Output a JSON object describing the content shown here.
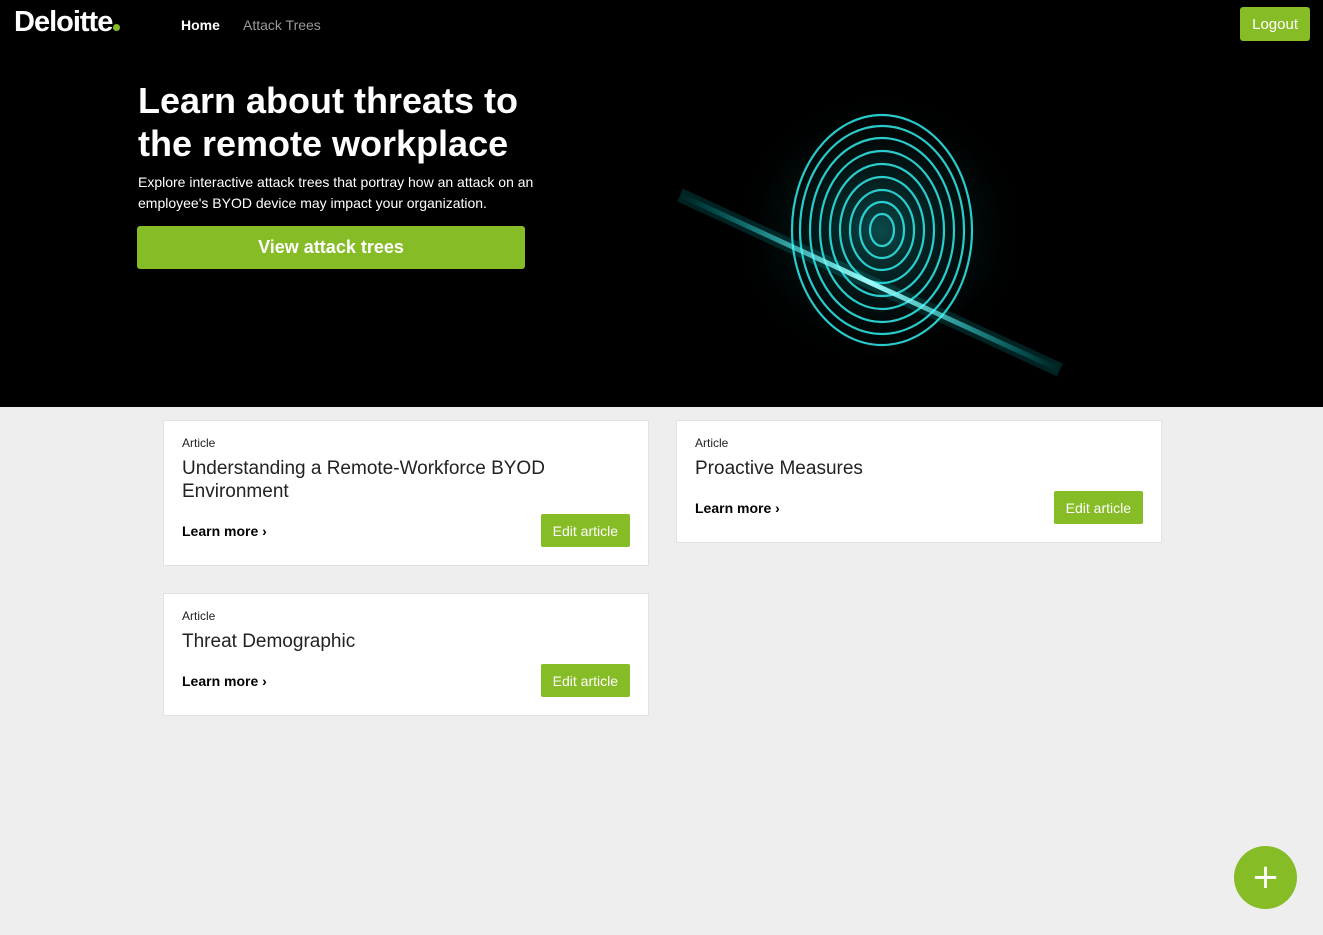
{
  "nav": {
    "brand": "Deloitte",
    "links": [
      {
        "label": "Home"
      },
      {
        "label": "Attack Trees"
      }
    ],
    "logout_label": "Logout"
  },
  "hero": {
    "title": "Learn about threats to the remote workplace",
    "subtitle": "Explore interactive attack trees that portray how an attack on an employee's BYOD device may impact your organization.",
    "cta_label": "View attack trees",
    "image_icon": "fingerprint-icon"
  },
  "articles": [
    {
      "kicker": "Article",
      "title": "Understanding a Remote-Workforce BYOD Environment",
      "link": "Learn more ›",
      "edit": "Edit article"
    },
    {
      "kicker": "Article",
      "title": "Proactive Measures",
      "link": "Learn more ›",
      "edit": "Edit article"
    },
    {
      "kicker": "Article",
      "title": "Threat Demographic",
      "link": "Learn more ›",
      "edit": "Edit article"
    }
  ],
  "fab": {
    "symbol": "+",
    "icon": "plus-icon"
  },
  "colors": {
    "accent": "#86bc25",
    "nav_bg": "#000000",
    "page_bg": "#eeeeee"
  }
}
